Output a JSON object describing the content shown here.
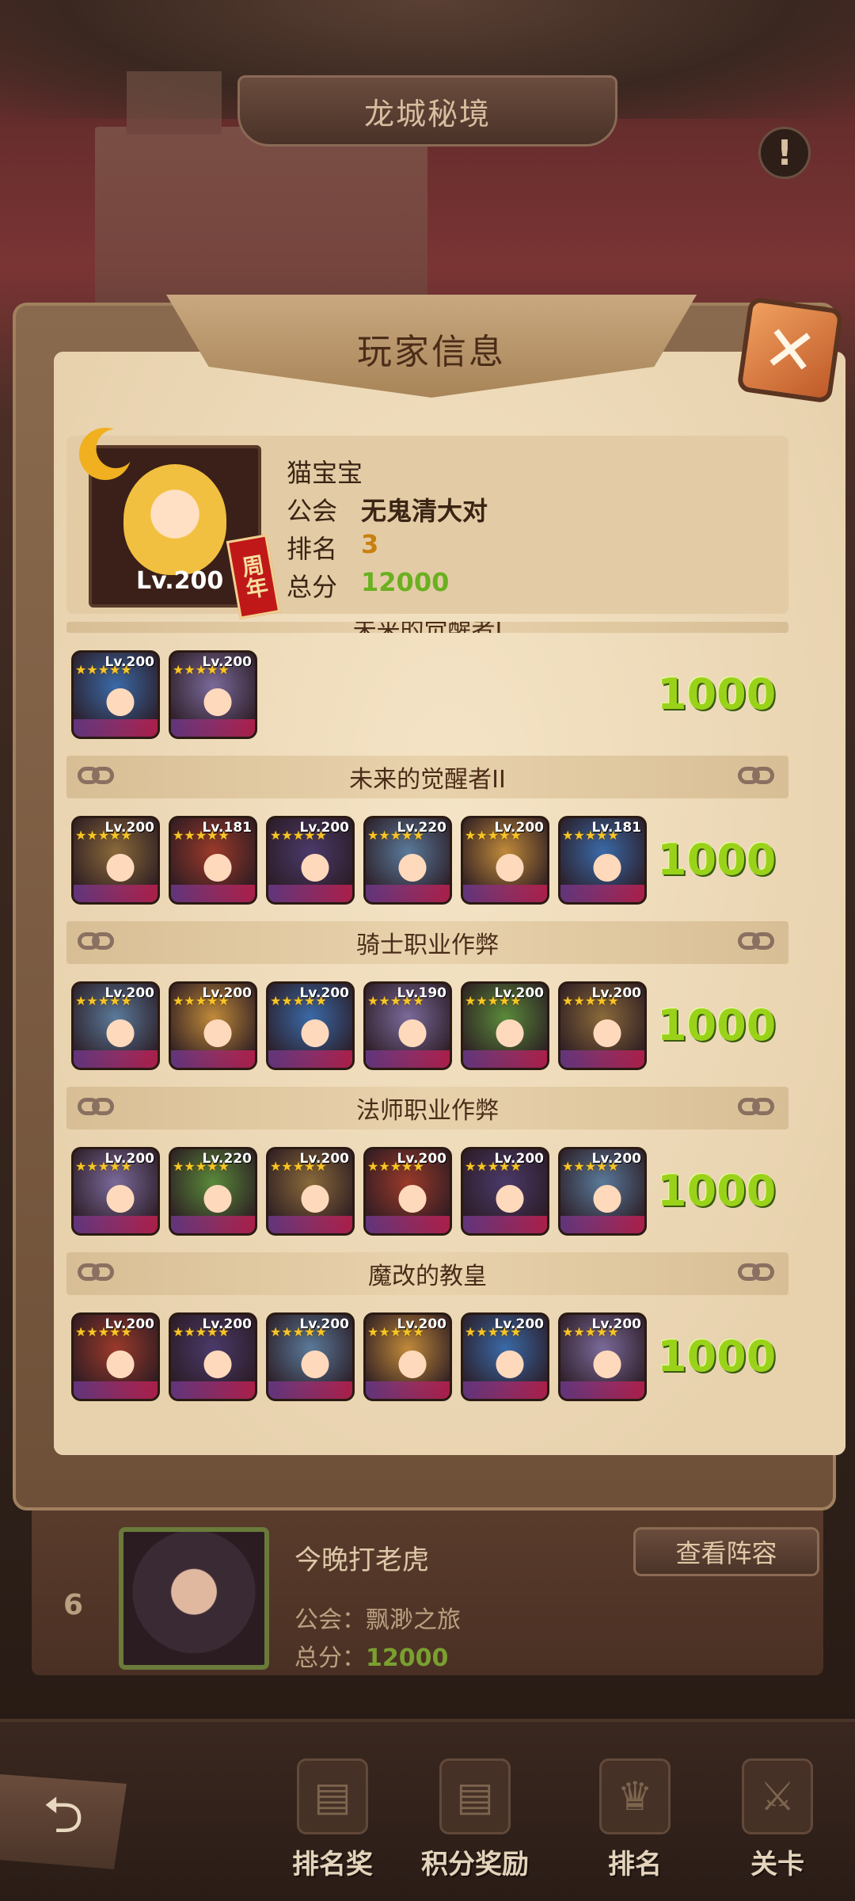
{
  "header": {
    "title": "龙城秘境",
    "info_icon": "!"
  },
  "modal": {
    "title": "玩家信息",
    "close_icon": "✕",
    "player": {
      "level": "Lv.200",
      "badge": "周年",
      "name": "猫宝宝",
      "guild_label": "公会",
      "guild": "无鬼清大对",
      "rank_label": "排名",
      "rank": "3",
      "score_label": "总分",
      "score": "12000"
    },
    "sections": [
      {
        "title": "未来的觉醒者I",
        "score": "1000",
        "heroes": [
          "Lv.200",
          "Lv.200"
        ]
      },
      {
        "title": "未来的觉醒者II",
        "score": "1000",
        "heroes": [
          "Lv.200",
          "Lv.181",
          "Lv.200",
          "Lv.220",
          "Lv.200",
          "Lv.181"
        ]
      },
      {
        "title": "骑士职业作弊",
        "score": "1000",
        "heroes": [
          "Lv.200",
          "Lv.200",
          "Lv.200",
          "Lv.190",
          "Lv.200",
          "Lv.200"
        ]
      },
      {
        "title": "法师职业作弊",
        "score": "1000",
        "heroes": [
          "Lv.200",
          "Lv.220",
          "Lv.200",
          "Lv.200",
          "Lv.200",
          "Lv.200"
        ]
      },
      {
        "title": "魔改的教皇",
        "score": "1000",
        "heroes": [
          "Lv.200",
          "Lv.200",
          "Lv.200",
          "Lv.200",
          "Lv.200",
          "Lv.200"
        ]
      }
    ]
  },
  "rank_entry": {
    "rank": "6",
    "name": "今晚打老虎",
    "guild": "公会：飘渺之旅",
    "score_label": "总分：",
    "score": "12000",
    "view_button": "查看阵容"
  },
  "nav": {
    "back_icon": "⮌",
    "items": [
      "排名奖",
      "积分奖励",
      "排名",
      "关卡"
    ]
  },
  "colors": {
    "score_green": "#9ad21a",
    "close_orange": "#e07838",
    "parchment": "#efdcbc"
  }
}
